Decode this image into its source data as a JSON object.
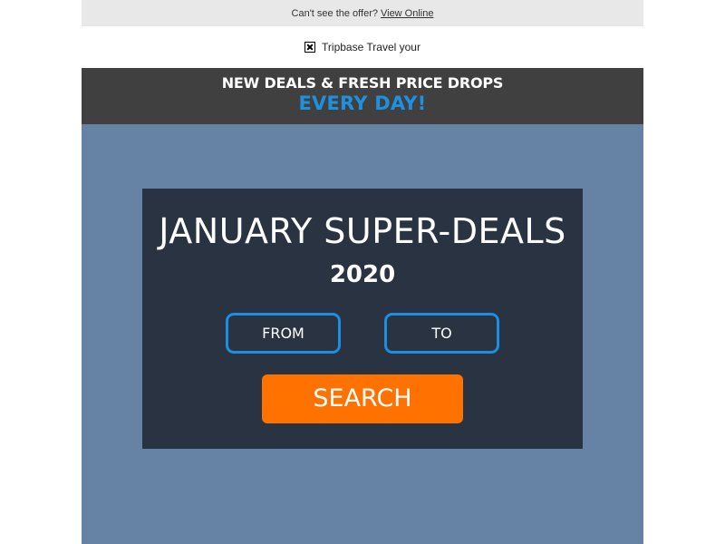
{
  "preheader": {
    "text": "Can't see the offer?",
    "link_label": "View Online"
  },
  "logo": {
    "icon": "broken-image-icon",
    "alt_text": "Tripbase Travel your"
  },
  "banner": {
    "line1": "NEW DEALS & FRESH PRICE DROPS",
    "line2": "EVERY DAY!"
  },
  "hero": {
    "title": "JANUARY SUPER-DEALS",
    "year": "2020",
    "from_label": "FROM",
    "to_label": "TO",
    "search_label": "SEARCH"
  },
  "colors": {
    "preheader_bg": "#e9e8e8",
    "banner_bg": "#404040",
    "accent_blue": "#1e90e0",
    "hero_bg": "#6683a6",
    "panel_bg": "#293342",
    "search_orange": "#ff7200"
  }
}
